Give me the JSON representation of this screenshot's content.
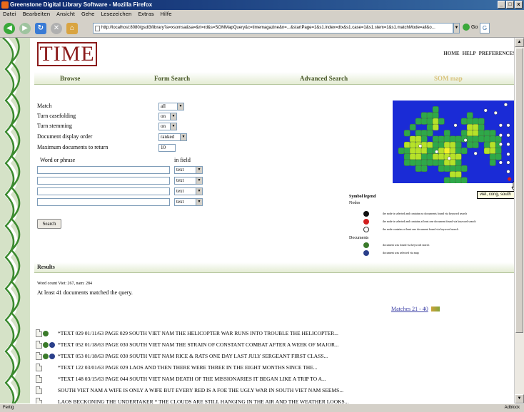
{
  "window": {
    "title": "Greenstone Digital Library Software - Mozilla Firefox",
    "buttons": [
      "_",
      "□",
      "x"
    ]
  },
  "menu": [
    "Datei",
    "Bearbeiten",
    "Ansicht",
    "Gehe",
    "Lesezeichen",
    "Extras",
    "Hilfe"
  ],
  "nav": {
    "url": "http://localhost:8080/gsdl3/library?a=xsomsa&sa=&rt=rd&s=SOMMapQuery&c=timemagazine&n=...&startPage=1&s1.index=dtx&s1.case=1&s1.stem=1&s1.matchMode=all&o...",
    "go_label": "Go"
  },
  "header": {
    "logo": "TIME",
    "links": [
      "HOME",
      "HELP",
      "PREFERENCES"
    ]
  },
  "tabs": [
    "Browse",
    "Form Search",
    "Advanced Search",
    "SOM map"
  ],
  "form": {
    "match_label": "Match",
    "match_value": "all",
    "casefold_label": "Turn casefolding",
    "casefold_value": "on",
    "stemming_label": "Turn stemming",
    "stemming_value": "on",
    "order_label": "Document display order",
    "order_value": "ranked",
    "maxdocs_label": "Maximum documents to return",
    "maxdocs_value": "10",
    "word_header": "Word or phrase",
    "field_header": "in field",
    "field_options": [
      "text",
      "text",
      "text",
      "text"
    ],
    "search_button": "Search"
  },
  "map": {
    "tooltip": "viet, cong, south",
    "colors": {
      "background": "#1a2bd6",
      "low": "#2ea84a",
      "mid": "#b6e22a",
      "high": "#f2f22a",
      "selected_red": "#d21f1f"
    }
  },
  "legend": {
    "title": "Symbol legend",
    "nodes_label": "Nodes",
    "node_items": [
      {
        "color": "#111111",
        "text": "the node is selected and contains no documents found via keyword search"
      },
      {
        "color": "#d21f1f",
        "text": "the node is selected and contains at least one document found via keyword search"
      },
      {
        "color": "#ffffff",
        "text": "the node contains at least one document found via keyword search"
      }
    ],
    "documents_label": "Documents",
    "document_items": [
      {
        "color": "#3a7a2a",
        "text": "document was found via keyword search"
      },
      {
        "color": "#2a3f8a",
        "text": "document was selected via map"
      }
    ]
  },
  "results": {
    "title": "Results",
    "word_count": "Word count Viet: 267, nam: 284",
    "summary": "At least 41 documents matched the query.",
    "matches_link": "Matches 21 - 40",
    "rows": [
      {
        "text": "*TEXT 029 01/11/63 PAGE 029 SOUTH VIET NAM THE HELICOPTER WAR RUNS INTO TROUBLE THE HELICOPTER...",
        "green": true,
        "blue": false
      },
      {
        "text": "*TEXT 052 01/18/63 PAGE 030 SOUTH VIET NAM THE STRAIN OF CONSTANT COMBAT AFTER A WEEK OF MAJOR...",
        "green": true,
        "blue": true
      },
      {
        "text": "*TEXT 053 01/18/63 PAGE 030 SOUTH VIET NAM RICE & RATS ONE DAY LAST JULY SERGEANT FIRST CLASS...",
        "green": true,
        "blue": true
      },
      {
        "text": "*TEXT 122 03/01/63 PAGE 029 LAOS AND THEN THERE WERE THREE IN THE EIGHT MONTHS SINCE THE...",
        "green": false,
        "blue": false
      },
      {
        "text": "*TEXT 148 03/15/63 PAGE 044 SOUTH VIET NAM DEATH OF THE MISSIONARIES IT BEGAN LIKE A TRIP TO A...",
        "green": false,
        "blue": false
      },
      {
        "text": "SOUTH VIET NAM A WIFE IS ONLY A WIFE BUT EVERY RED IS A FOE THE UGLY WAR IN SOUTH VIET NAM SEEMS...",
        "green": false,
        "blue": false
      },
      {
        "text": "LAOS BECKONING THE UNDERTAKER * THE CLOUDS ARE STILL HANGING IN THE AIR AND THE WEATHER LOOKS...",
        "green": false,
        "blue": false
      }
    ]
  },
  "status": {
    "left": "Fertig",
    "right": "Adblock"
  }
}
